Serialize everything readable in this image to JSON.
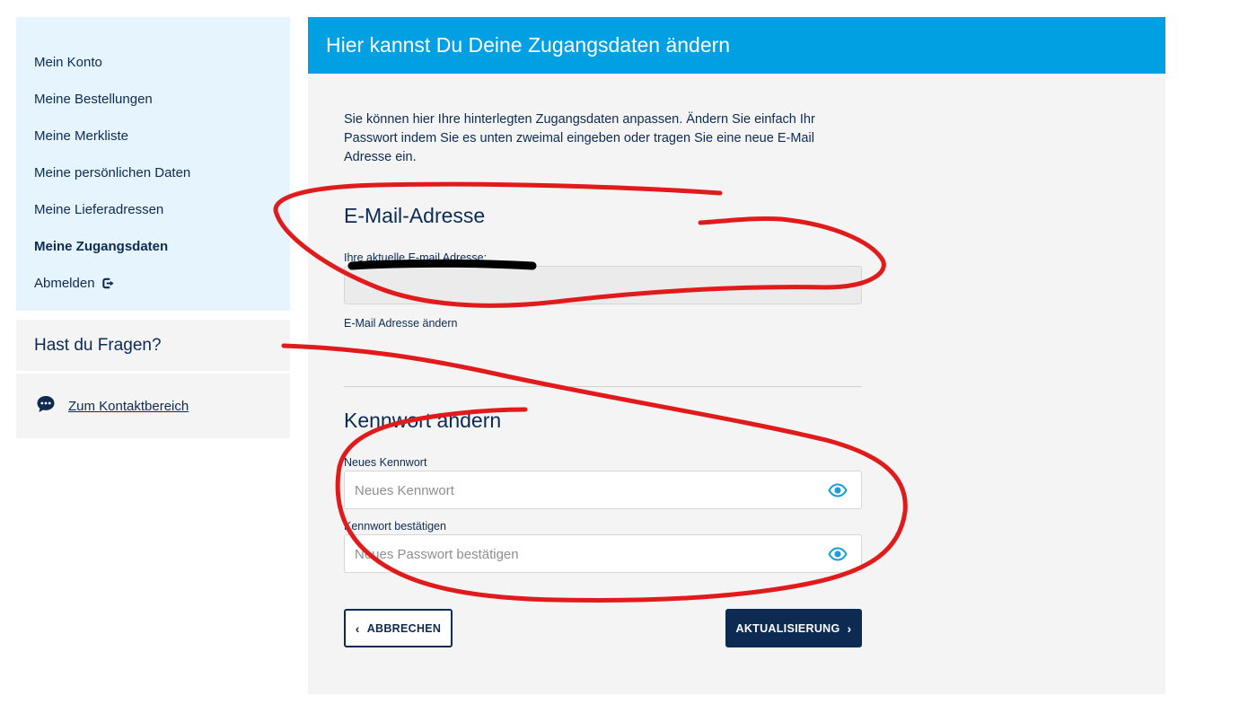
{
  "sidebar": {
    "items": [
      {
        "label": "Mein Konto"
      },
      {
        "label": "Meine Bestellungen"
      },
      {
        "label": "Meine Merkliste"
      },
      {
        "label": "Meine persönlichen Daten"
      },
      {
        "label": "Meine Lieferadressen"
      },
      {
        "label": "Meine Zugangsdaten",
        "active": true
      },
      {
        "label": "Abmelden",
        "icon": "logout-icon"
      }
    ],
    "help_title": "Hast du Fragen?",
    "contact_link": "Zum Kontaktbereich",
    "contact_icon": "chat-bubble-icon"
  },
  "main": {
    "header": "Hier kannst Du Deine Zugangsdaten ändern",
    "intro": "Sie können hier Ihre hinterlegten Zugangsdaten anpassen. Ändern Sie einfach Ihr Passwort indem Sie es unten zweimal eingeben oder tragen Sie eine neue E-Mail Adresse ein.",
    "email_section": {
      "title": "E-Mail-Adresse",
      "current_label": "Ihre aktuelle E-mail Adresse:",
      "change_link": "E-Mail Adresse ändern"
    },
    "password_section": {
      "title": "Kennwort ändern",
      "new_label": "Neues Kennwort",
      "new_placeholder": "Neues Kennwort",
      "confirm_label": "Kennwort bestätigen",
      "confirm_placeholder": "Neues Passwort bestätigen",
      "eye_icon": "eye-icon"
    },
    "buttons": {
      "cancel": "ABBRECHEN",
      "update": "AKTUALISIERUNG"
    }
  },
  "colors": {
    "header_bg": "#00a0e3",
    "navy": "#0d2b52",
    "sidebar_bg": "#e6f4fd",
    "panel_bg": "#f4f4f4",
    "annotation_red": "#e11b1b",
    "redaction_black": "#000000"
  }
}
